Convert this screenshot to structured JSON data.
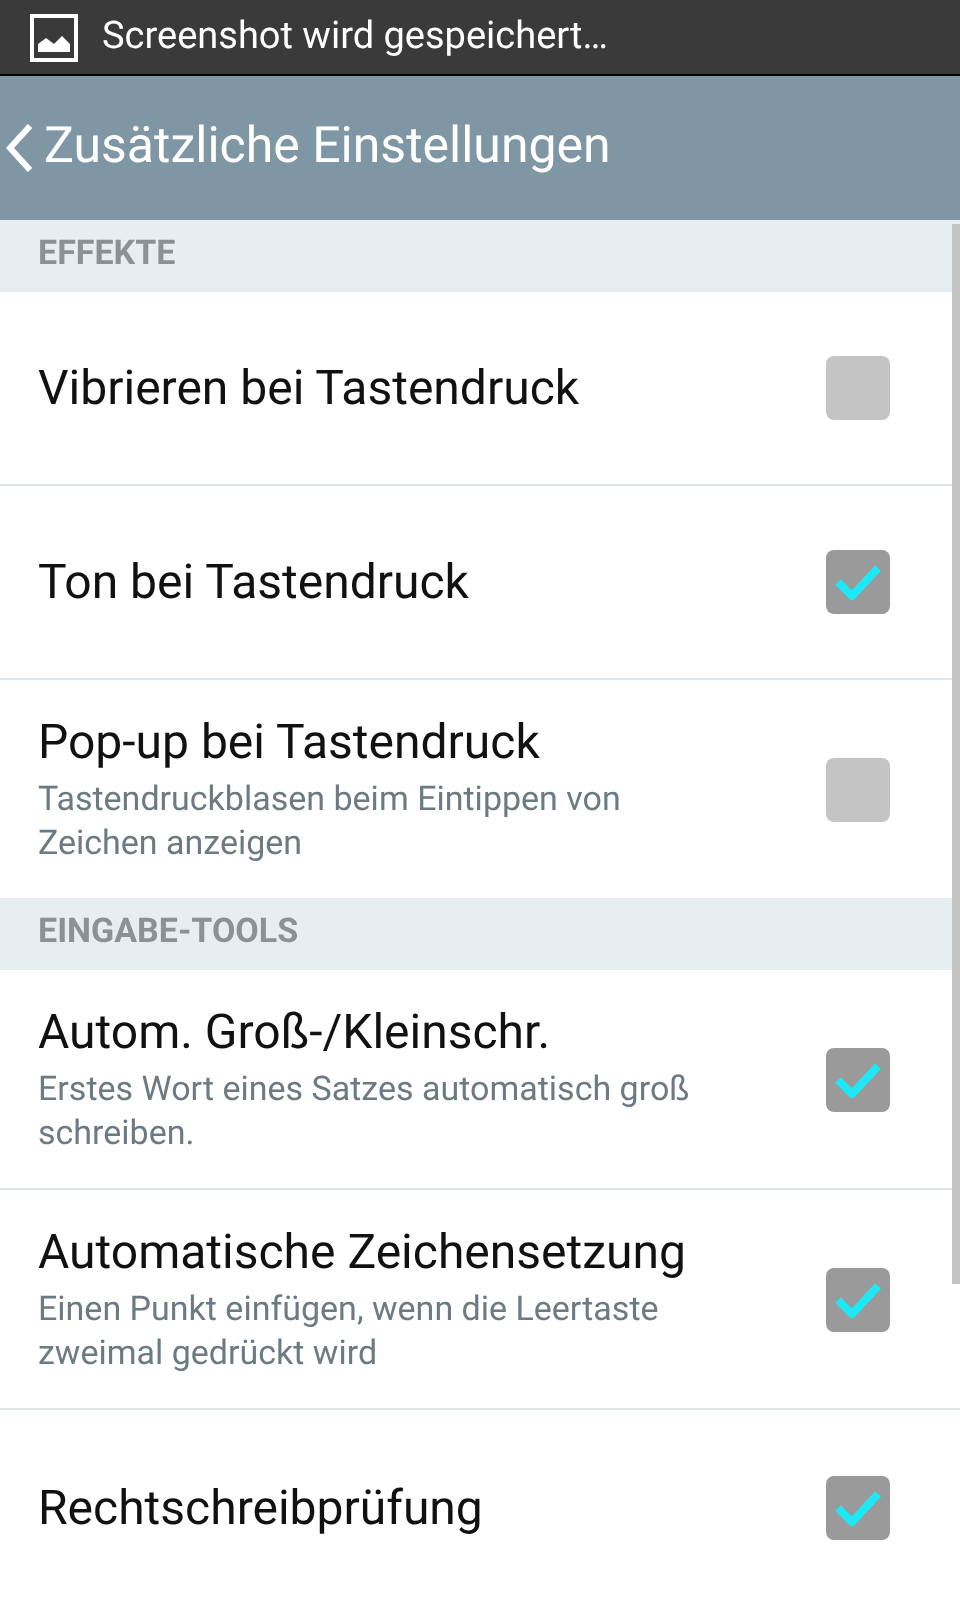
{
  "status_bar": {
    "notification": "Screenshot wird gespeichert…"
  },
  "header": {
    "title": "Zusätzliche Einstellungen"
  },
  "sections": [
    {
      "title": "EFFEKTE",
      "items": [
        {
          "title": "Vibrieren bei Tastendruck",
          "checked": false
        },
        {
          "title": "Ton bei Tastendruck",
          "checked": true
        },
        {
          "title": "Pop-up bei Tastendruck",
          "subtitle": "Tastendruckblasen beim Eintippen von Zeichen anzeigen",
          "checked": false
        }
      ]
    },
    {
      "title": "EINGABE-TOOLS",
      "items": [
        {
          "title": "Autom. Groß-/Kleinschr.",
          "subtitle": "Erstes Wort eines Satzes automatisch groß schreiben.",
          "checked": true
        },
        {
          "title": "Automatische Zeichensetzung",
          "subtitle": "Einen Punkt einfügen, wenn die Leertaste zweimal gedrückt wird",
          "checked": true
        },
        {
          "title": "Rechtschreibprüfung",
          "checked": true
        }
      ]
    }
  ]
}
